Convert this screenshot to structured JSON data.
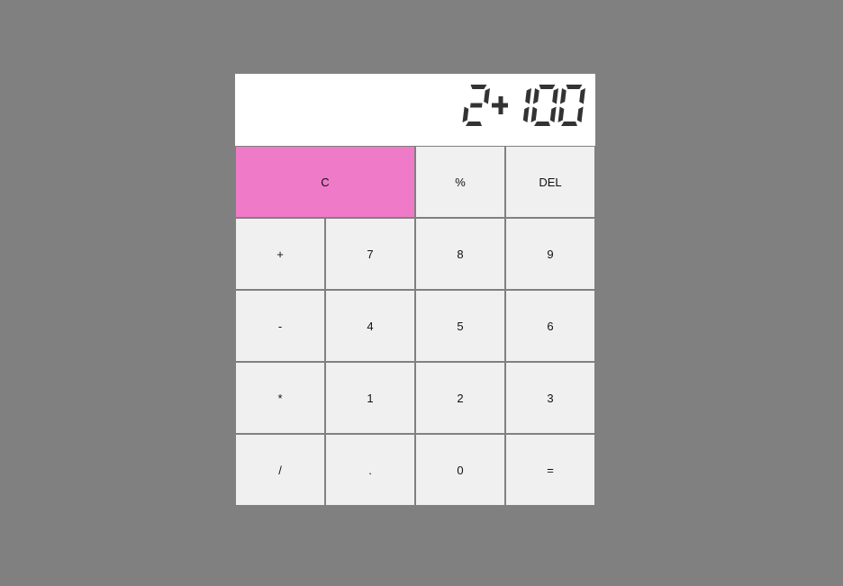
{
  "display": {
    "expression": "2+100",
    "digit_color": "#333333"
  },
  "colors": {
    "background": "#808080",
    "key_bg": "#f0f0f0",
    "clear_key_bg": "#ee7ac8",
    "display_bg": "#ffffff"
  },
  "keys": {
    "clear": "C",
    "percent": "%",
    "delete": "DEL",
    "plus": "+",
    "seven": "7",
    "eight": "8",
    "nine": "9",
    "minus": "-",
    "four": "4",
    "five": "5",
    "six": "6",
    "multiply": "*",
    "one": "1",
    "two": "2",
    "three": "3",
    "divide": "/",
    "decimal": ".",
    "zero": "0",
    "equals": "="
  }
}
